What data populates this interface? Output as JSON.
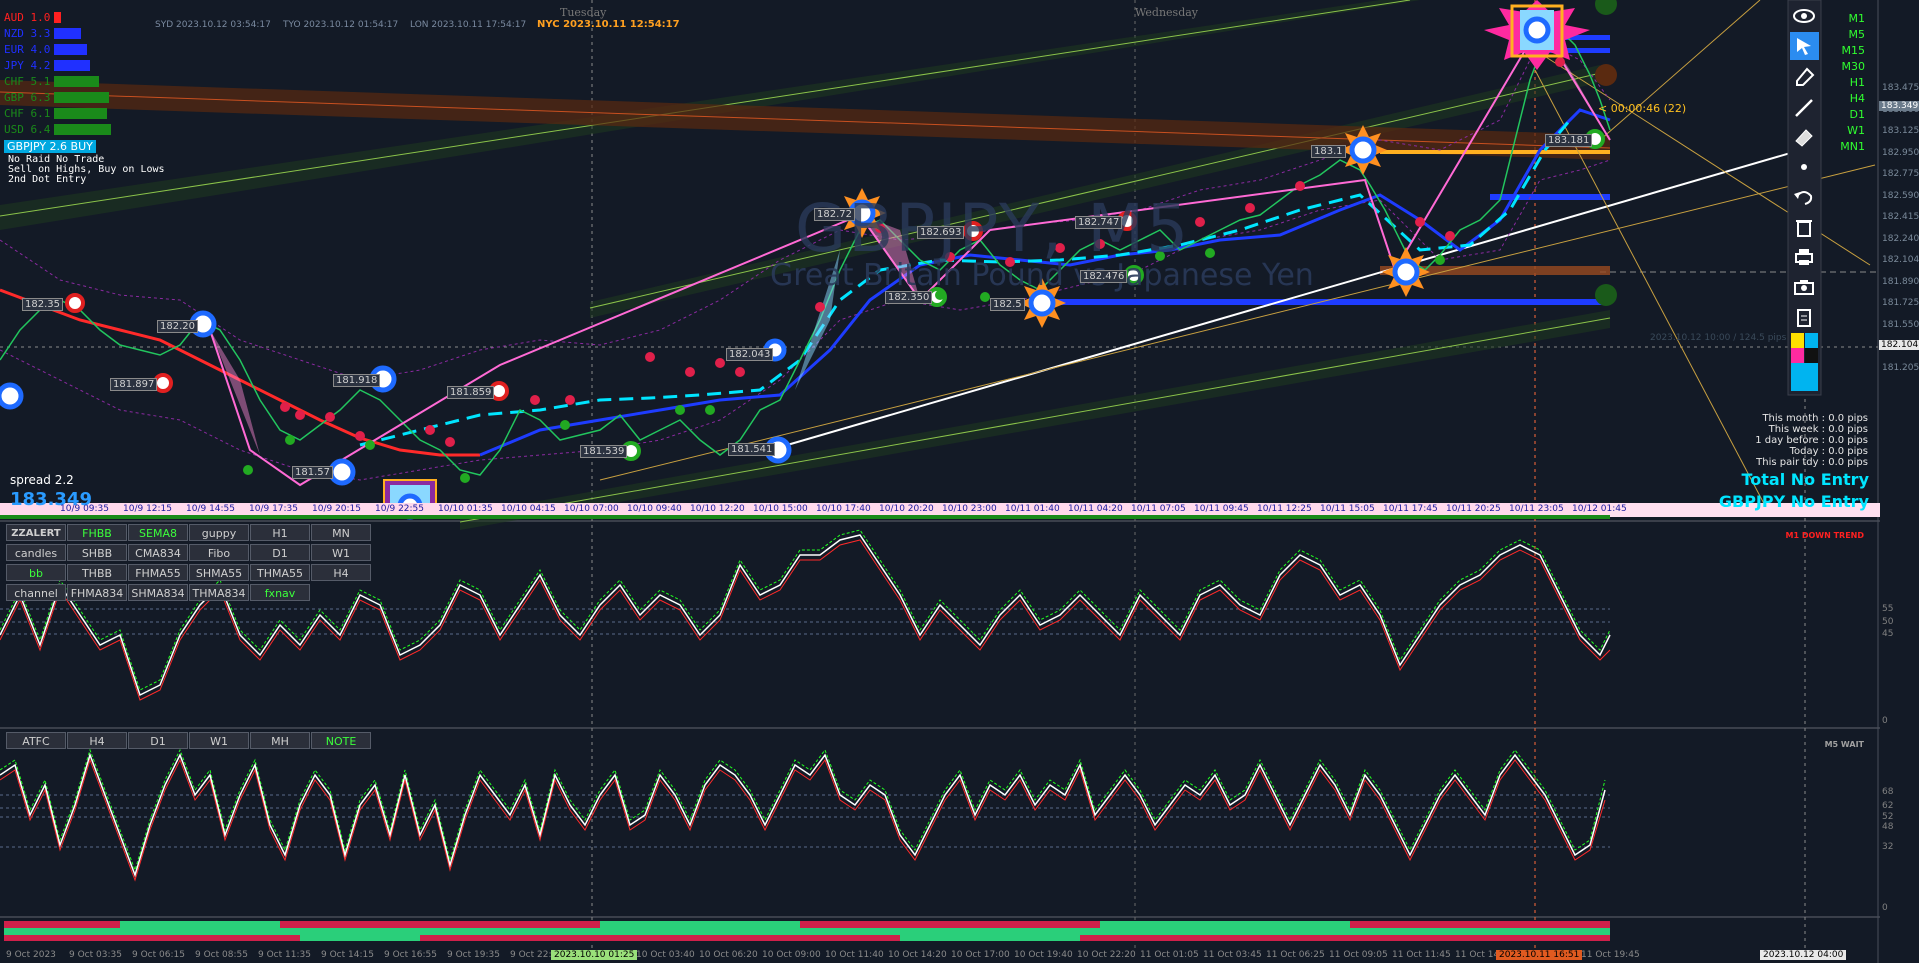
{
  "sessions": {
    "sydney": "SYD 2023.10.12 03:54:17",
    "tokyo": "TYO 2023.10.12 01:54:17",
    "london": "LON 2023.10.11 17:54:17",
    "newyork": "NYC 2023.10.11 12:54:17",
    "day_tuesday": "Tuesday",
    "day_wednesday": "Wednesday"
  },
  "currency_strength": [
    {
      "label": "AUD  1.0",
      "color": "#ff2020",
      "bar_color": "#ff2020",
      "bar_fraction": 0.12
    },
    {
      "label": "NZD  3.3",
      "color": "#2030ff",
      "bar_color": "#2030ff",
      "bar_fraction": 0.45
    },
    {
      "label": "EUR  4.0",
      "color": "#2030ff",
      "bar_color": "#2030ff",
      "bar_fraction": 0.55
    },
    {
      "label": "JPY  4.2",
      "color": "#2030ff",
      "bar_color": "#2030ff",
      "bar_fraction": 0.6
    },
    {
      "label": "CHF  5.1",
      "color": "#1a8a1a",
      "bar_color": "#1a8a1a",
      "bar_fraction": 0.75
    },
    {
      "label": "GBP  6.3",
      "color": "#1a8a1a",
      "bar_color": "#1a8a1a",
      "bar_fraction": 0.92
    },
    {
      "label": "CHF  6.1",
      "color": "#1a8a1a",
      "bar_color": "#1a8a1a",
      "bar_fraction": 0.88
    },
    {
      "label": "USD  6.4",
      "color": "#1a8a1a",
      "bar_color": "#1a8a1a",
      "bar_fraction": 0.95
    }
  ],
  "pair_signal": "GBPJPY 2.6 BUY",
  "notes": [
    "No Raid No Trade",
    "Sell on Highs, Buy on Lows",
    "2nd Dot Entry"
  ],
  "watermark": {
    "symbol": "GBPJPY, M5",
    "name": "Great Britain Pound vs Japanese Yen"
  },
  "spread": "spread 2.2",
  "current_price": "183.349",
  "countdown": "< 00:00:46 (22)",
  "price_labels": [
    {
      "text": "182.35"
    },
    {
      "text": "182.20"
    },
    {
      "text": "181.897"
    },
    {
      "text": "181.918"
    },
    {
      "text": "181.859"
    },
    {
      "text": "181.57"
    },
    {
      "text": "181.539"
    },
    {
      "text": "182.043"
    },
    {
      "text": "181.541"
    },
    {
      "text": "182.72"
    },
    {
      "text": "182.693"
    },
    {
      "text": "182.350"
    },
    {
      "text": "182.5"
    },
    {
      "text": "182.747"
    },
    {
      "text": "182.476"
    },
    {
      "text": "183.1"
    },
    {
      "text": "183.181"
    }
  ],
  "right_axis": [
    "183.475",
    "183.300",
    "183.125",
    "182.950",
    "182.775",
    "182.590",
    "182.415",
    "182.240",
    "182.104",
    "181.890",
    "181.725",
    "181.550",
    "181.375",
    "181.205"
  ],
  "axis_current": "183.349",
  "axis_marker": "182.104",
  "timeframes": [
    "M1",
    "M5",
    "M15",
    "M30",
    "H1",
    "H4",
    "D1",
    "W1",
    "MN1"
  ],
  "stats": [
    "This month : 0.0 pips",
    "This week : 0.0 pips",
    "1 day before : 0.0 pips",
    "Today : 0.0 pips",
    "This pair tdy : 0.0 pips"
  ],
  "total_entry": "Total No Entry",
  "pair_entry": "GBPJPY No Entry",
  "m1_down_trend": "M1 DOWN TREND",
  "m5_wait": "M5 WAIT",
  "session_stamp": "2023.10.12 10:00 / 124.5 pips",
  "bottom_time_labels": [
    "10/9 09:35",
    "10/9 12:15",
    "10/9 14:55",
    "10/9 17:35",
    "10/9 20:15",
    "10/9 22:55",
    "10/10 01:35",
    "10/10 04:15",
    "10/10 07:00",
    "10/10 09:40",
    "10/10 12:20",
    "10/10 15:00",
    "10/10 17:40",
    "10/10 20:20",
    "10/10 23:00",
    "10/11 01:40",
    "10/11 04:20",
    "10/11 07:05",
    "10/11 09:45",
    "10/11 12:25",
    "10/11 15:05",
    "10/11 17:45",
    "10/11 20:25",
    "10/11 23:05",
    "10/12 01:45"
  ],
  "footer_time_labels": [
    "9 Oct 2023",
    "9 Oct 03:35",
    "9 Oct 06:15",
    "9 Oct 08:55",
    "9 Oct 11:35",
    "9 Oct 14:15",
    "9 Oct 16:55",
    "9 Oct 19:35",
    "9 Oct 22:15",
    "10 Oct 01:25",
    "10 Oct 03:40",
    "10 Oct 06:20",
    "10 Oct 09:00",
    "10 Oct 11:40",
    "10 Oct 14:20",
    "10 Oct 17:00",
    "10 Oct 19:40",
    "10 Oct 22:20",
    "11 Oct 01:05",
    "11 Oct 03:45",
    "11 Oct 06:25",
    "11 Oct 09:05",
    "11 Oct 11:45",
    "11 Oct 14:25",
    "11 Oct 17:05",
    "11 Oct 19:45"
  ],
  "footer_highlight_left": "2023.10.10 01:25",
  "footer_highlight_mid": "2023.10.11 16:51",
  "footer_highlight_right": "2023.10.12 04:00",
  "panel1_buttons": [
    [
      "ZZALERT",
      "FHBB",
      "SEMA8",
      "guppy",
      "H1",
      "MN"
    ],
    [
      "candles",
      "SHBB",
      "CMA834",
      "Fibo",
      "D1",
      "W1"
    ],
    [
      "bb",
      "THBB",
      "FHMA55",
      "SHMA55",
      "THMA55",
      "H4"
    ],
    [
      "channel",
      "FHMA834",
      "SHMA834",
      "THMA834",
      "fxnav"
    ]
  ],
  "panel2_buttons": [
    "ATFC",
    "H4",
    "D1",
    "W1",
    "MH",
    "NOTE"
  ],
  "osc1_levels": [
    "55",
    "50",
    "45",
    "0"
  ],
  "osc2_levels": [
    "68",
    "62",
    "52",
    "48",
    "32",
    "0"
  ],
  "tools": [
    "eye-icon",
    "cursor-icon",
    "eraser-icon",
    "line-icon",
    "ruler-icon",
    "dot-icon",
    "undo-icon",
    "trash-icon",
    "printer-icon",
    "camera-icon",
    "clipboard-icon",
    "palette-icon"
  ]
}
